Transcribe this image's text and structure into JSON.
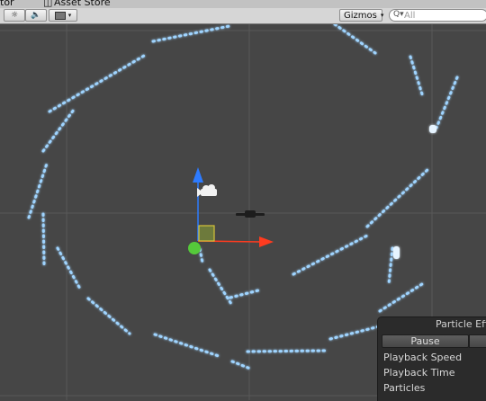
{
  "tabs": {
    "first": "tor",
    "asset_store": "Asset Store"
  },
  "toolbar": {
    "gizmos_label": "Gizmos",
    "search_placeholder": "All",
    "icons": [
      "sun-icon",
      "speaker-icon",
      "image-icon",
      "dropdown-arrow-icon"
    ]
  },
  "particle_panel": {
    "title": "Particle Eff",
    "pause_label": "Pause",
    "rows": [
      "Playback Speed",
      "Playback Time",
      "Particles"
    ]
  },
  "colors": {
    "scene_bg": "#464646",
    "particle": "#9fd4ff",
    "axis_y": "#2d7bff",
    "axis_x": "#ff3b1f",
    "axis_z": "#55c93a"
  }
}
